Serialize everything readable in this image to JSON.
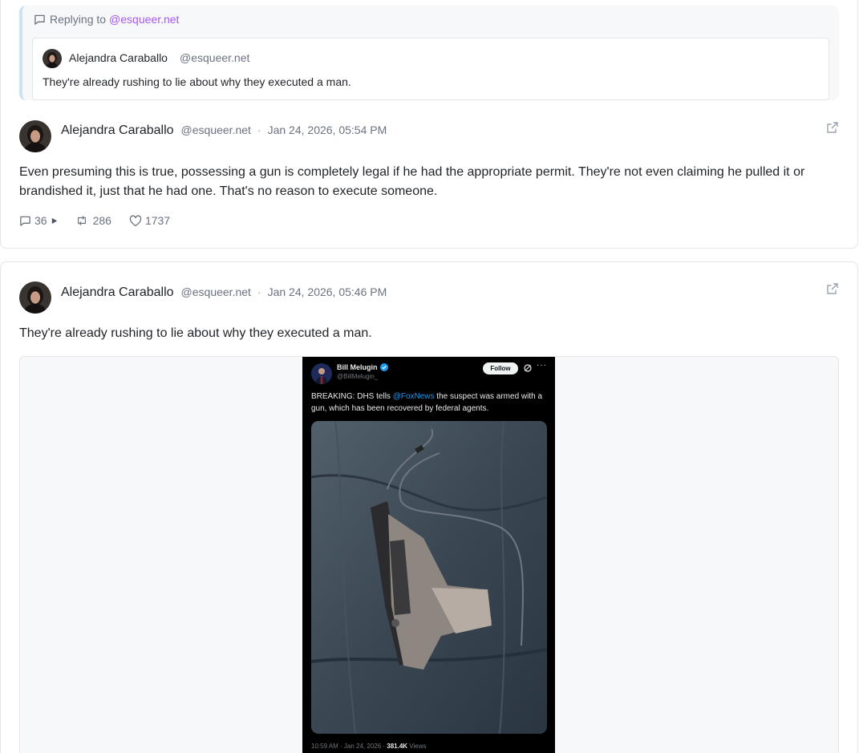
{
  "post1": {
    "reply": {
      "prefix": "Replying to",
      "handle": "@esqueer.net",
      "quote": {
        "author": "Alejandra Caraballo",
        "handle": "@esqueer.net",
        "text": "They're already rushing to lie about why they executed a man."
      }
    },
    "author": "Alejandra Caraballo",
    "handle": "@esqueer.net",
    "separator": "·",
    "date": "Jan 24, 2026, 05:54 PM",
    "text": "Even presuming this is true, possessing a gun is completely legal if he had the appropriate permit. They're not even claiming he pulled it or brandished it, just that he had one. That's no reason to execute someone.",
    "stats": {
      "replies": "36",
      "reposts": "286",
      "likes": "1737"
    }
  },
  "post2": {
    "author": "Alejandra Caraballo",
    "handle": "@esqueer.net",
    "separator": "·",
    "date": "Jan 24, 2026, 05:46 PM",
    "text": "They're already rushing to lie about why they executed a man.",
    "embed": {
      "name": "Bill Melugin",
      "handle": "@BillMelugin_",
      "follow_label": "Follow",
      "more": "···",
      "text_before": "BREAKING: DHS tells ",
      "mention": "@FoxNews",
      "text_after": " the suspect was armed with a gun, which has been recovered by federal agents.",
      "time": "10:59 AM · Jan 24, 2026 · ",
      "views": "381.4K",
      "views_label": " Views"
    }
  },
  "colors": {
    "link_purple": "#a855f7",
    "reply_border": "#c9e3f4",
    "twitter_blue": "#1d9bf0"
  },
  "icons": [
    "comment-icon",
    "play-icon",
    "repost-icon",
    "heart-icon",
    "external-link-icon",
    "verified-icon",
    "grok-icon"
  ]
}
